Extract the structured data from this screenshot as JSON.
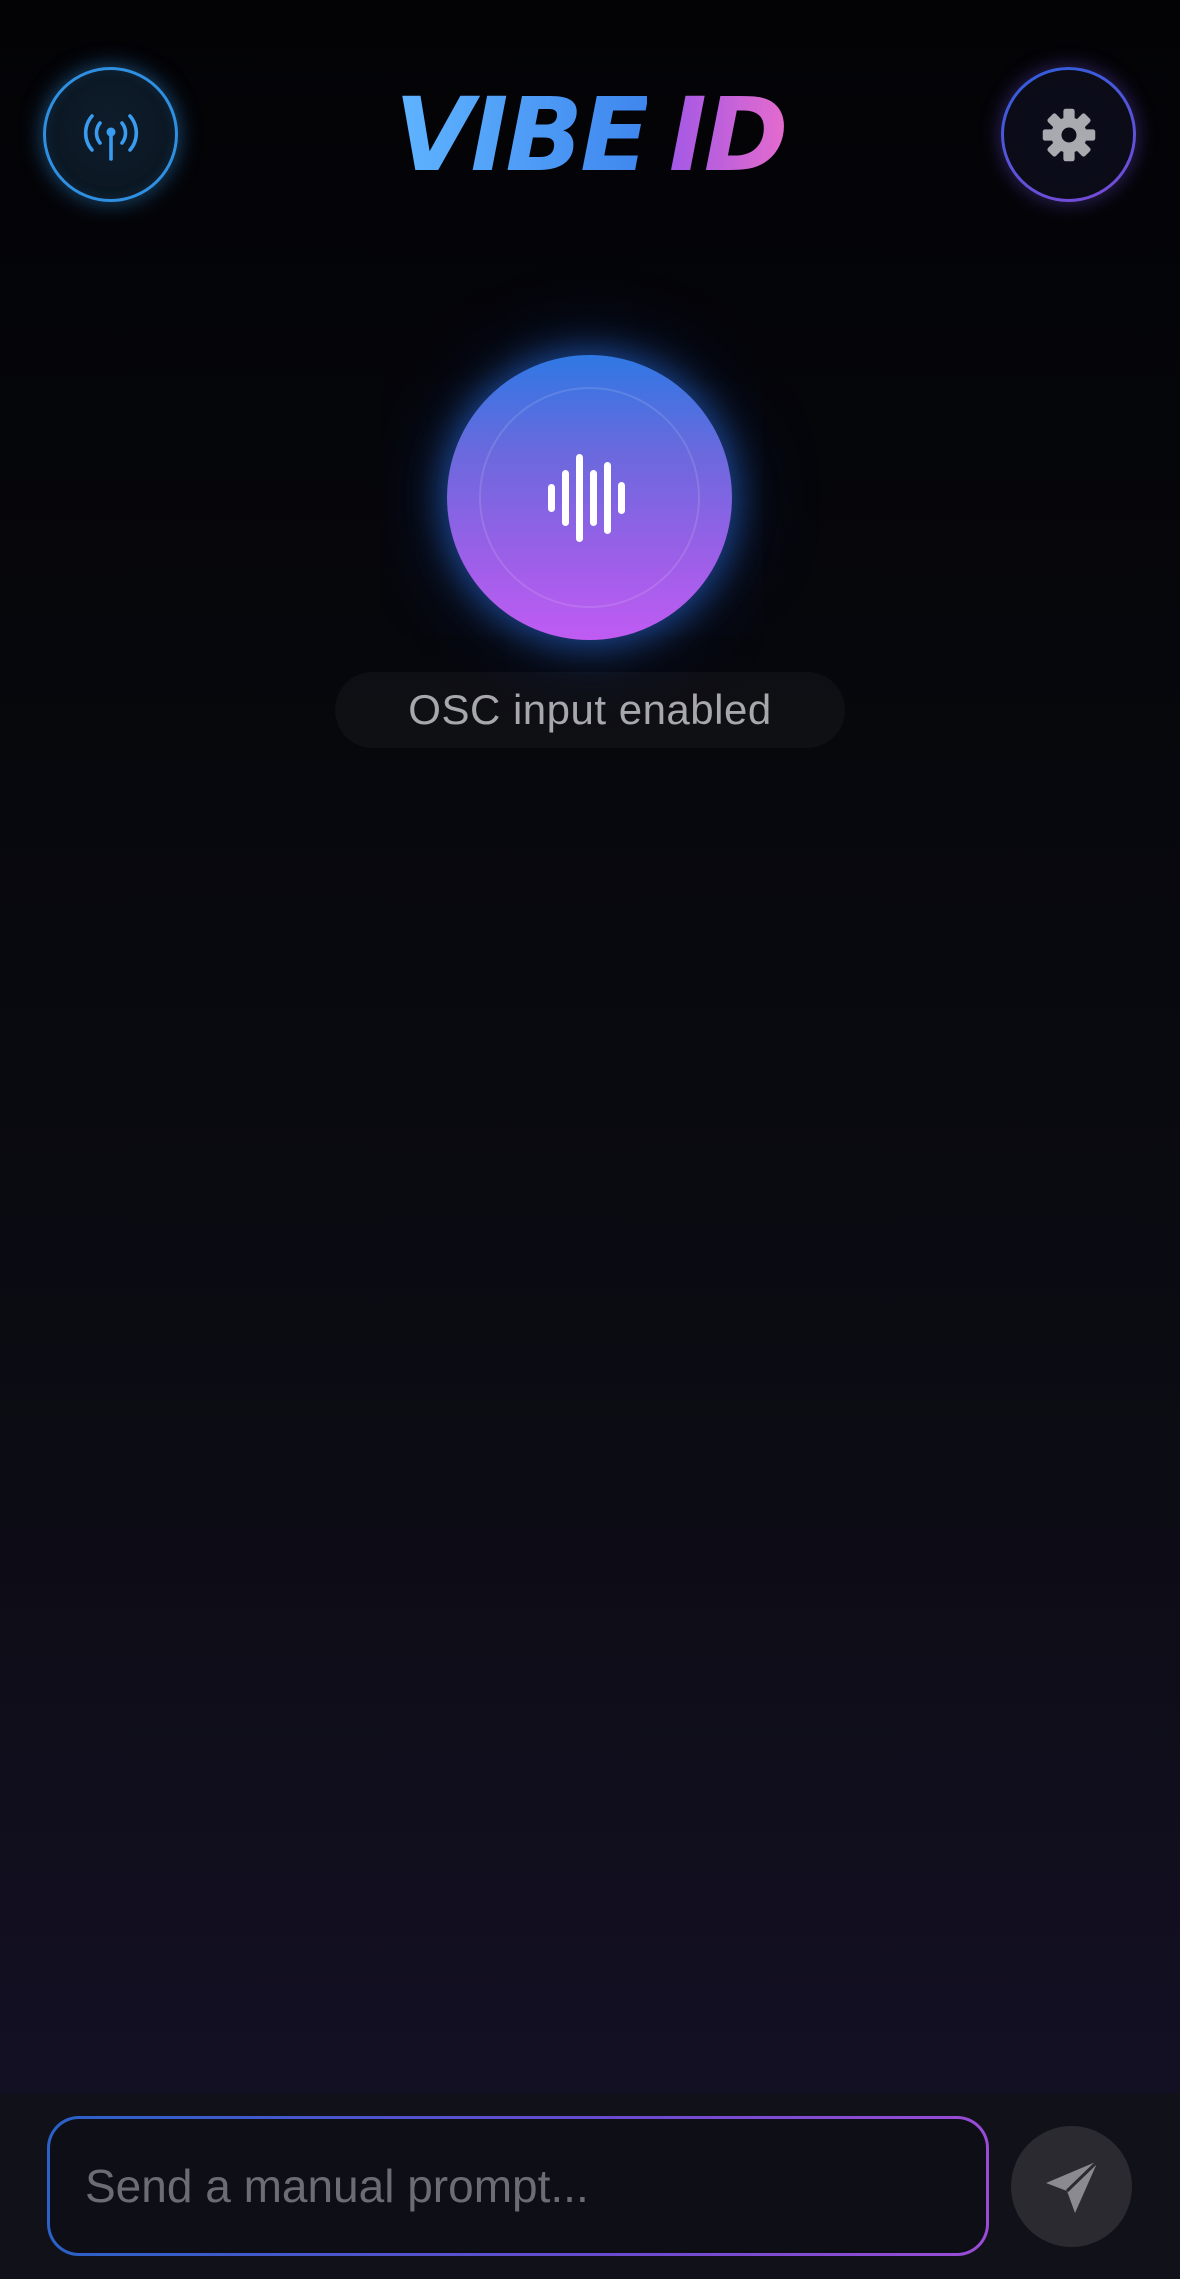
{
  "header": {
    "logo_part1": "VIBE",
    "logo_part2": "ID",
    "left_icon": "broadcast-antenna-icon",
    "right_icon": "gear-icon"
  },
  "main": {
    "orb_icon": "waveform-icon",
    "status_text": "OSC input enabled"
  },
  "composer": {
    "placeholder": "Send a manual prompt...",
    "value": "",
    "send_icon": "paper-plane-icon"
  },
  "colors": {
    "accent_blue": "#2f8fe0",
    "accent_purple": "#a258e6",
    "accent_pink": "#e46bcd",
    "background": "#05060a"
  }
}
